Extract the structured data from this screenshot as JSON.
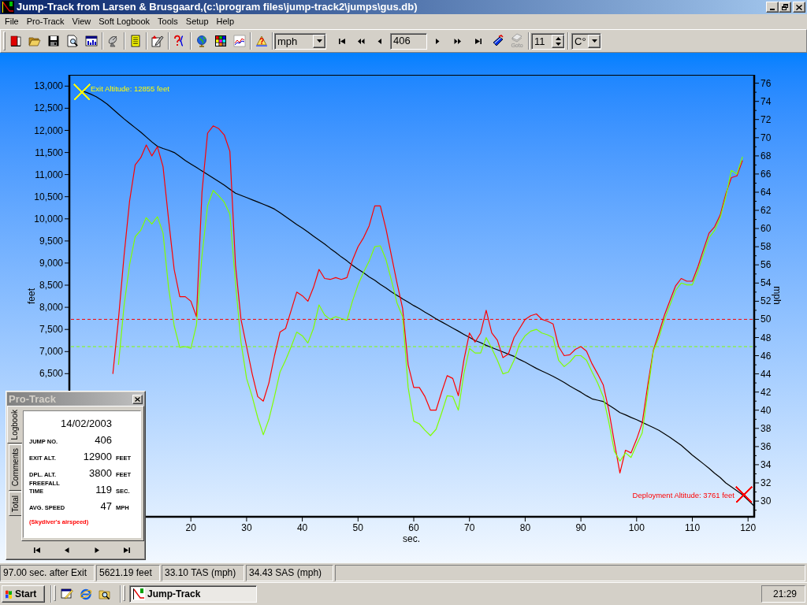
{
  "window": {
    "title": "Jump-Track from Larsen & Brusgaard,(c:\\program files\\jump-track2\\jumps\\gus.db)"
  },
  "menu": [
    "File",
    "Pro-Track",
    "View",
    "Soft Logbook",
    "Tools",
    "Setup",
    "Help"
  ],
  "toolbar": {
    "unit_select": {
      "value": "mph"
    },
    "jump_field": {
      "value": "406"
    },
    "goto_button": {
      "label": "Goto",
      "disabled": true
    },
    "spin_field": {
      "value": "11"
    },
    "temperature_select": {
      "value": "C°"
    }
  },
  "chart": {
    "chart_data": {
      "type": "line",
      "xlabel": "sec.",
      "ylabel": "feet",
      "y2label": "mph",
      "x": [
        0,
        1,
        2,
        3,
        4,
        5,
        6,
        7,
        8,
        9,
        10,
        11,
        12,
        13,
        14,
        15,
        16,
        17,
        18,
        19,
        20,
        21,
        22,
        23,
        24,
        25,
        26,
        27,
        28,
        29,
        30,
        31,
        32,
        33,
        34,
        35,
        36,
        37,
        38,
        39,
        40,
        41,
        42,
        43,
        44,
        45,
        46,
        47,
        48,
        49,
        50,
        51,
        52,
        53,
        54,
        55,
        56,
        57,
        58,
        59,
        60,
        61,
        62,
        63,
        64,
        65,
        66,
        67,
        68,
        69,
        70,
        71,
        72,
        73,
        74,
        75,
        76,
        77,
        78,
        79,
        80,
        81,
        82,
        83,
        84,
        85,
        86,
        87,
        88,
        89,
        90,
        91,
        92,
        93,
        94,
        95,
        96,
        97,
        98,
        99,
        100,
        101,
        102,
        103,
        104,
        105,
        106,
        107,
        108,
        109,
        110,
        111,
        112,
        113,
        114,
        115,
        116,
        117,
        118,
        119,
        120,
        121
      ],
      "series": [
        {
          "color": "#000000",
          "values": [
            12900,
            12870,
            12820,
            12760,
            12680,
            12590,
            12480,
            12370,
            12260,
            12160,
            12060,
            11960,
            11850,
            11740,
            11640,
            11590,
            11550,
            11500,
            11410,
            11320,
            11240,
            11160,
            11080,
            11000,
            10920,
            10840,
            10760,
            10670,
            10580,
            10530,
            10480,
            10430,
            10380,
            10330,
            10280,
            10220,
            10140,
            10050,
            9960,
            9870,
            9790,
            9700,
            9610,
            9520,
            9430,
            9330,
            9240,
            9140,
            9050,
            8950,
            8860,
            8780,
            8690,
            8610,
            8520,
            8440,
            8350,
            8270,
            8190,
            8120,
            8040,
            7970,
            7890,
            7820,
            7740,
            7670,
            7600,
            7530,
            7460,
            7390,
            7320,
            7250,
            7200,
            7140,
            7090,
            7040,
            6990,
            6940,
            6890,
            6820,
            6760,
            6690,
            6620,
            6560,
            6500,
            6440,
            6370,
            6300,
            6220,
            6150,
            6080,
            6000,
            5930,
            5900,
            5870,
            5790,
            5710,
            5620,
            5570,
            5510,
            5460,
            5400,
            5340,
            5280,
            5220,
            5140,
            5060,
            4970,
            4880,
            4770,
            4660,
            4560,
            4460,
            4360,
            4250,
            4150,
            4030,
            3940,
            3850,
            3760,
            3640,
            3520
          ]
        },
        {
          "color": "#ff0000",
          "axis": "y2",
          "values": [
            null,
            null,
            null,
            null,
            null,
            null,
            44,
            50,
            57,
            63,
            67,
            67.8,
            69.2,
            68,
            69,
            66.8,
            61,
            55.5,
            52.5,
            52.5,
            52,
            50.3,
            64,
            70.5,
            71.3,
            71,
            70.3,
            68.5,
            56,
            50,
            47,
            44,
            41.5,
            41,
            43,
            46,
            48.6,
            49,
            51,
            53,
            52.6,
            52,
            53.5,
            55.5,
            54.5,
            54.4,
            54.6,
            54.4,
            54.6,
            56.5,
            58,
            59,
            60.3,
            62.5,
            62.5,
            60,
            57,
            54,
            51.2,
            45,
            42.5,
            42.5,
            41.5,
            40,
            40,
            42,
            43.8,
            43.5,
            41.6,
            45.5,
            48.5,
            47.5,
            48.5,
            51,
            48.5,
            47.7,
            45.8,
            46.2,
            48,
            49,
            50,
            50.4,
            50.6,
            50,
            49.8,
            49.5,
            47,
            46,
            46.1,
            46.7,
            47,
            46.5,
            45.1,
            44,
            42.8,
            40,
            36.5,
            33.1,
            35.6,
            35.3,
            36.8,
            38.6,
            42.8,
            46.6,
            48.5,
            50.5,
            52.1,
            53.7,
            54.5,
            54.2,
            54.2,
            55.8,
            57.7,
            59.5,
            60.2,
            61.5,
            63.8,
            65.6,
            65.8,
            67.5,
            null,
            null
          ]
        },
        {
          "color": "#80ff00",
          "axis": "y2",
          "values": [
            null,
            null,
            null,
            null,
            null,
            null,
            null,
            45,
            51.5,
            56,
            59.1,
            59.8,
            61.2,
            60.5,
            61.3,
            59.5,
            53.5,
            49.3,
            46.9,
            47,
            46.8,
            49.4,
            57,
            62.5,
            64.2,
            63.6,
            62.9,
            61.6,
            54,
            47.5,
            43.5,
            41.5,
            39.2,
            37.3,
            39,
            41.5,
            44.2,
            45.5,
            47,
            48.6,
            48.2,
            47.4,
            49,
            51.6,
            50.5,
            50,
            50.3,
            50.1,
            49.9,
            52,
            53.8,
            55.2,
            56.4,
            58,
            58.1,
            56.6,
            54.3,
            51.8,
            50.3,
            42.5,
            38.8,
            38.5,
            37.8,
            37.2,
            37.9,
            39.7,
            41.6,
            41.5,
            40,
            44,
            46.8,
            46.3,
            46.3,
            48,
            46.8,
            45.5,
            44,
            44.2,
            45.5,
            47.3,
            48.2,
            48.7,
            48.9,
            48.5,
            48.3,
            48,
            45.5,
            44.8,
            45.3,
            46,
            46,
            45.5,
            44.2,
            43,
            41.5,
            38.7,
            35.5,
            34.4,
            35.3,
            34.8,
            36.2,
            37.5,
            42,
            46.5,
            48,
            50,
            51.6,
            53.2,
            54,
            53.8,
            53.8,
            55.3,
            57.2,
            59,
            59.8,
            61.2,
            63.5,
            66.4,
            66,
            67.9,
            null,
            null
          ]
        }
      ],
      "xlim": [
        -1.81,
        121.1
      ],
      "ylim": [
        3265,
        13255
      ],
      "y2lim": [
        28.27,
        76.92
      ],
      "xticks": [
        20,
        30,
        40,
        50,
        60,
        70,
        80,
        90,
        100,
        110,
        120
      ],
      "yticks": [
        {
          "value": 6500,
          "label": "6,500"
        },
        {
          "value": 7000,
          "label": "7,000"
        },
        {
          "value": 7500,
          "label": "7,500"
        },
        {
          "value": 8000,
          "label": "8,000"
        },
        {
          "value": 8500,
          "label": "8,500"
        },
        {
          "value": 9000,
          "label": "9,000"
        },
        {
          "value": 9500,
          "label": "9,500"
        },
        {
          "value": 10000,
          "label": "10,000"
        },
        {
          "value": 10500,
          "label": "10,500"
        },
        {
          "value": 11000,
          "label": "11,000"
        },
        {
          "value": 11500,
          "label": "11,500"
        },
        {
          "value": 12000,
          "label": "12,000"
        },
        {
          "value": 12500,
          "label": "12,500"
        },
        {
          "value": 13000,
          "label": "13,000"
        }
      ],
      "y2ticks": [
        30,
        32,
        34,
        36,
        38,
        40,
        42,
        44,
        46,
        48,
        50,
        52,
        54,
        56,
        58,
        60,
        62,
        64,
        66,
        68,
        70,
        72,
        74,
        76
      ],
      "ref_lines": [
        {
          "axis": "y2",
          "value": 50,
          "color": "#ff0000"
        },
        {
          "axis": "y2",
          "value": 47,
          "color": "#80ff00"
        }
      ],
      "annotations": [
        {
          "x": 0.4,
          "y": 12855,
          "text": "Exit Altitude: 12855 feet"
        },
        {
          "x": 119.2,
          "y": 3761,
          "text": "Deployment Altitude: 3761 feet"
        }
      ]
    },
    "annotation_styles": [
      {
        "color": "#ffff00"
      },
      {
        "color": "#ff0000"
      }
    ]
  },
  "pro_track_panel": {
    "title": "Pro-Track",
    "tabs": [
      {
        "label": "Logbook",
        "selected": true
      },
      {
        "label": "Comments",
        "selected": false
      },
      {
        "label": "Total",
        "selected": false
      }
    ],
    "date": "14/02/2003",
    "rows": [
      {
        "label": "JUMP NO.",
        "value": "406"
      },
      {
        "label": "EXIT ALT.",
        "value": "12900",
        "unit": "FEET"
      },
      {
        "label": "DPL. ALT.",
        "value": "3800",
        "unit": "FEET"
      },
      {
        "label": "FREEFALL TIME",
        "value": "119",
        "unit": "SEC."
      },
      {
        "label": "AVG. SPEED",
        "value": "47",
        "unit": "MPH"
      }
    ],
    "note": "(Skydiver's airspeed)"
  },
  "status_bar": [
    "97.00 sec. after Exit",
    "5621.19 feet",
    "33.10 TAS (mph)",
    "34.43 SAS (mph)"
  ],
  "taskbar": {
    "start": "Start",
    "tasks": [
      {
        "label": "Jump-Track",
        "selected": true
      }
    ],
    "clock": "21:29"
  }
}
